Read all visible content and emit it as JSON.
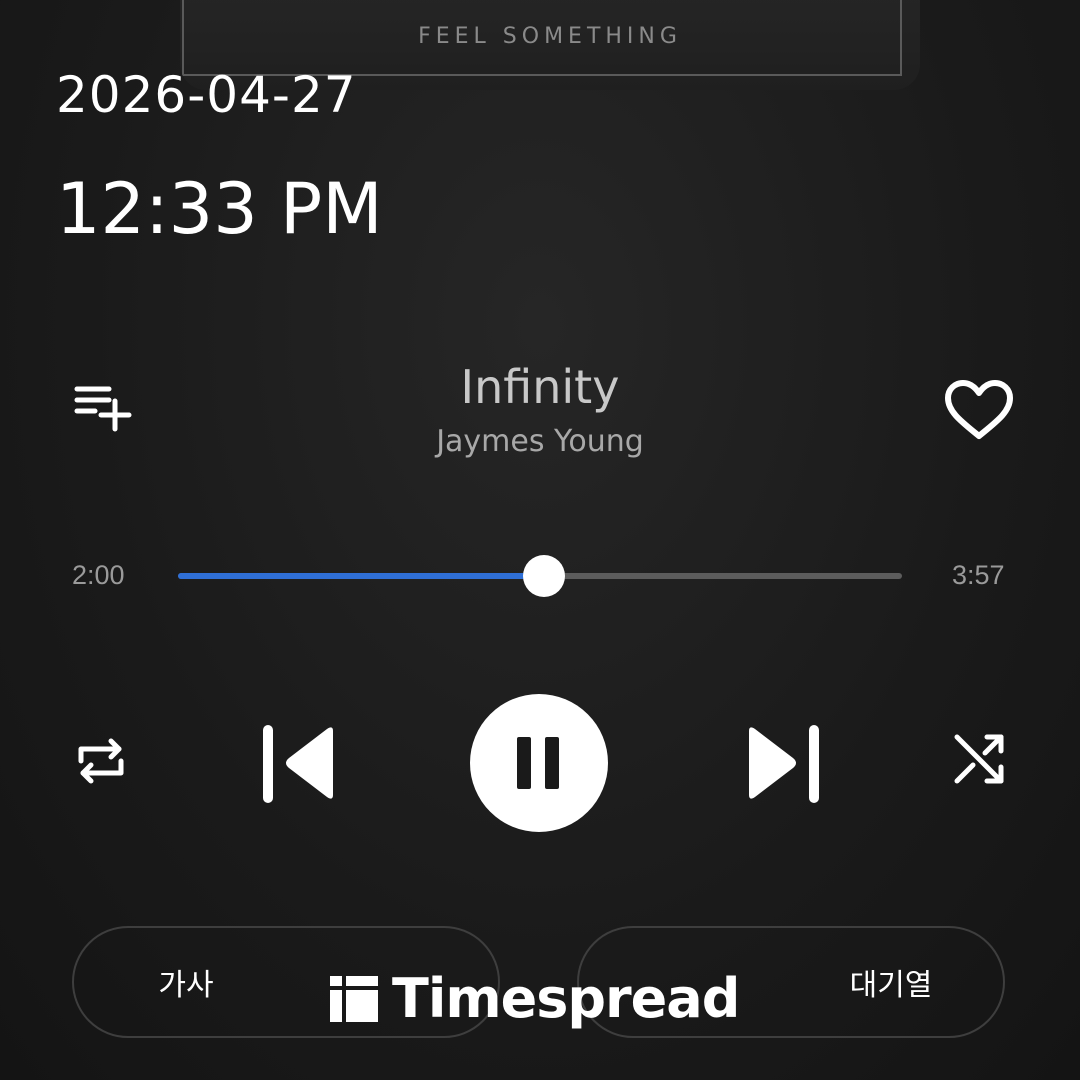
{
  "album": {
    "art_text": "FEEL SOMETHING"
  },
  "status": {
    "date": "2026-04-27",
    "time": "12:33 PM"
  },
  "track": {
    "title": "Infinity",
    "artist": "Jaymes Young"
  },
  "playback": {
    "elapsed": "2:00",
    "duration": "3:57",
    "progress_fraction": 0.506,
    "state": "playing",
    "accent_color": "#2f6fd6"
  },
  "actions": {
    "lyrics_label": "가사",
    "queue_label": "대기열"
  },
  "icons": {
    "add_to_queue": "playlist-add-icon",
    "like": "heart-outline-icon",
    "repeat": "repeat-icon",
    "previous": "skip-previous-icon",
    "pause": "pause-icon",
    "next": "skip-next-icon",
    "shuffle": "shuffle-icon"
  },
  "watermark": {
    "text": "Timespread"
  }
}
